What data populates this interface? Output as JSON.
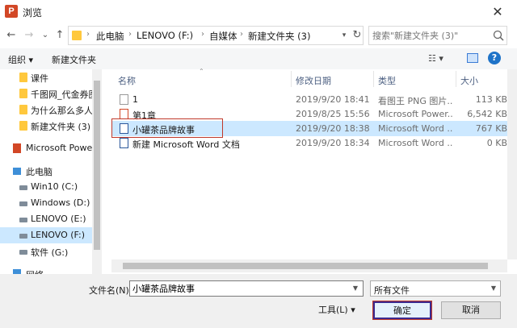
{
  "window": {
    "title": "浏览",
    "app_icon_letter": "P"
  },
  "nav": {
    "back_icon": "←",
    "forward_icon": "→",
    "dropdown_icon": "⌄",
    "up_icon": "↑"
  },
  "address": {
    "crumbs": [
      "此电脑",
      "LENOVO (F:)",
      "自媒体",
      "新建文件夹 (3)"
    ],
    "separator": "›"
  },
  "search": {
    "placeholder": "搜索\"新建文件夹 (3)\""
  },
  "toolbar": {
    "organize_label": "组织 ▾",
    "new_folder_label": "新建文件夹",
    "view_label": "☷ ▾",
    "help_label": "?"
  },
  "sidebar": {
    "items": [
      {
        "label": "课件",
        "icon": "folder-icon"
      },
      {
        "label": "千图网_代金券图",
        "icon": "folder-icon"
      },
      {
        "label": "为什么那么多人扌",
        "icon": "folder-icon"
      },
      {
        "label": "新建文件夹 (3)",
        "icon": "folder-icon"
      },
      {
        "label": "Microsoft Power",
        "icon": "powerpoint-icon"
      },
      {
        "label": "此电脑",
        "icon": "computer-icon"
      },
      {
        "label": "Win10 (C:)",
        "icon": "drive-icon"
      },
      {
        "label": "Windows (D:)",
        "icon": "drive-icon"
      },
      {
        "label": "LENOVO (E:)",
        "icon": "drive-icon"
      },
      {
        "label": "LENOVO (F:)",
        "icon": "drive-icon",
        "selected": true
      },
      {
        "label": "软件 (G:)",
        "icon": "drive-icon"
      },
      {
        "label": "网络",
        "icon": "network-icon"
      }
    ]
  },
  "filelist": {
    "columns": [
      "名称",
      "修改日期",
      "类型",
      "大小"
    ],
    "rows": [
      {
        "name": "1",
        "date": "2019/9/20 18:41",
        "type": "看图王 PNG 图片...",
        "size": "113 KB",
        "icon": "png-file-icon"
      },
      {
        "name": "第1章",
        "date": "2019/8/25 15:56",
        "type": "Microsoft Power...",
        "size": "6,542 KB",
        "icon": "pptx-file-icon"
      },
      {
        "name": "小罐茶品牌故事",
        "date": "2019/9/20 18:38",
        "type": "Microsoft Word ...",
        "size": "767 KB",
        "icon": "docx-file-icon",
        "selected": true
      },
      {
        "name": "新建 Microsoft Word 文档",
        "date": "2019/9/20 18:34",
        "type": "Microsoft Word ...",
        "size": "0 KB",
        "icon": "docx-file-icon"
      }
    ]
  },
  "footer": {
    "filename_label": "文件名(N):",
    "filename_value": "小罐茶品牌故事",
    "filetype_value": "所有文件",
    "tools_label": "工具(L)  ▾",
    "ok_label": "确定",
    "cancel_label": "取消"
  },
  "colors": {
    "selection": "#cce8ff",
    "highlight_border": "#c0392b",
    "folder": "#ffc83d"
  }
}
